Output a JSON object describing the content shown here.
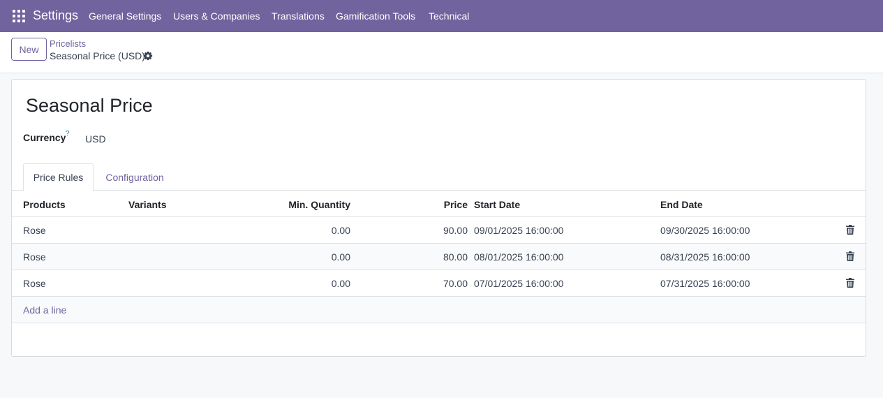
{
  "navbar": {
    "app_title": "Settings",
    "menu": [
      "General Settings",
      "Users & Companies",
      "Translations",
      "Gamification Tools",
      "Technical"
    ]
  },
  "controlbar": {
    "new_label": "New",
    "breadcrumb_parent": "Pricelists",
    "breadcrumb_current": "Seasonal Price (USD)"
  },
  "form": {
    "title": "Seasonal Price",
    "currency_label": "Currency",
    "currency_help": "?",
    "currency_value": "USD"
  },
  "tabs": [
    "Price Rules",
    "Configuration"
  ],
  "table": {
    "columns": [
      "Products",
      "Variants",
      "Min. Quantity",
      "Price",
      "Start Date",
      "End Date"
    ],
    "rows": [
      {
        "product": "Rose",
        "variant": "",
        "min_qty": "0.00",
        "price": "90.00",
        "start": "09/01/2025 16:00:00",
        "end": "09/30/2025 16:00:00"
      },
      {
        "product": "Rose",
        "variant": "",
        "min_qty": "0.00",
        "price": "80.00",
        "start": "08/01/2025 16:00:00",
        "end": "08/31/2025 16:00:00"
      },
      {
        "product": "Rose",
        "variant": "",
        "min_qty": "0.00",
        "price": "70.00",
        "start": "07/01/2025 16:00:00",
        "end": "07/31/2025 16:00:00"
      }
    ],
    "add_line": "Add a line"
  },
  "colors": {
    "brand": "#71639e",
    "background": "#f7f8fa"
  }
}
